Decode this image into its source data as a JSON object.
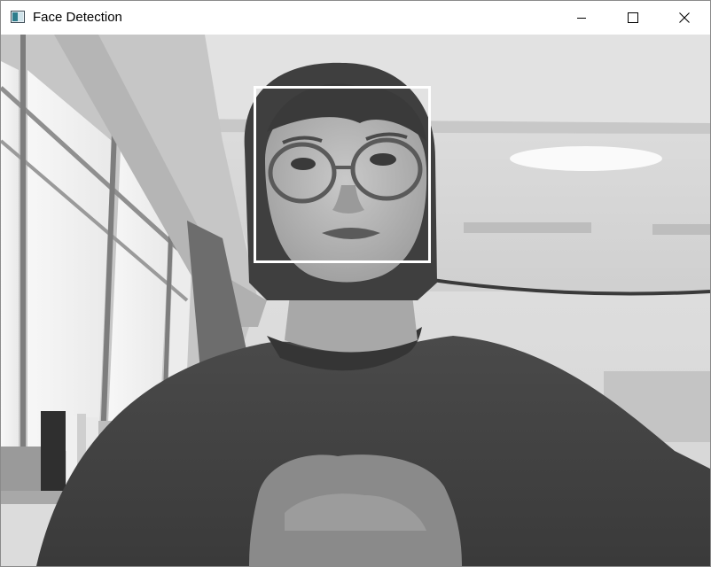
{
  "window": {
    "title": "Face Detection",
    "app_icon": "opencv-window-icon",
    "controls": {
      "minimize_icon": "minimize-icon",
      "maximize_icon": "maximize-icon",
      "close_icon": "close-icon"
    }
  },
  "video_frame": {
    "mode": "grayscale",
    "detections": [
      {
        "label": "face",
        "box_color": "#ffffff"
      }
    ]
  }
}
